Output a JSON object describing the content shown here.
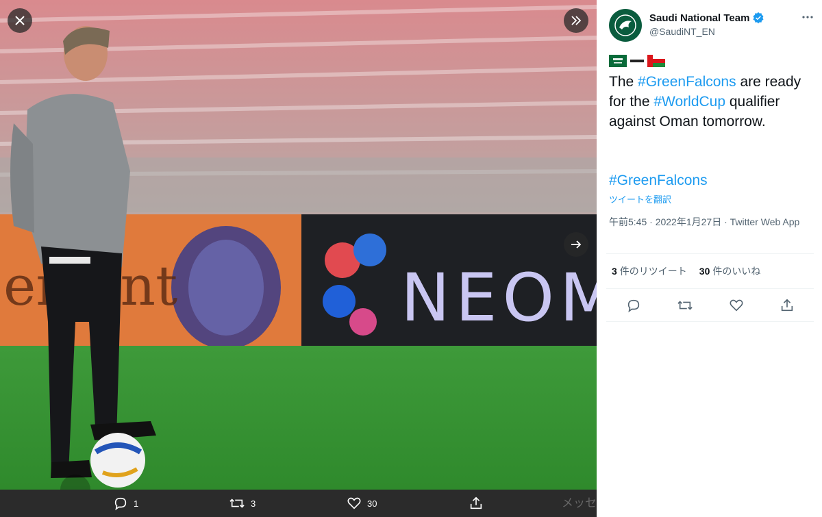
{
  "viewer": {
    "photo_alt": "Coach standing with foot on a football in a stadium",
    "bar": {
      "reply_count": "1",
      "retweet_count": "3",
      "like_count": "30"
    },
    "ghost_text": "メッセ"
  },
  "tweet": {
    "display_name": "Saudi National Team",
    "handle": "@SaudiNT_EN",
    "verified": true,
    "text_prefix": "The ",
    "hashtag1": "#GreenFalcons",
    "text_mid": " are ready for the ",
    "hashtag2": "#WorldCup",
    "text_suffix": " qualifier against Oman tomorrow.",
    "hashtag_line": "#GreenFalcons",
    "translate": "ツイートを翻訳",
    "timestamp": "午前5:45 · 2022年1月27日 · Twitter Web App",
    "retweets_num": "3",
    "retweets_label": "件のリツイート",
    "likes_num": "30",
    "likes_label": "件のいいね",
    "flag_icons": [
      "saudi-flag-icon",
      "dash-icon",
      "oman-flag-icon"
    ]
  },
  "colors": {
    "accent": "#1d9bf0",
    "verified": "#1d9bf0",
    "avatar_bg": "#0a5c3e"
  }
}
